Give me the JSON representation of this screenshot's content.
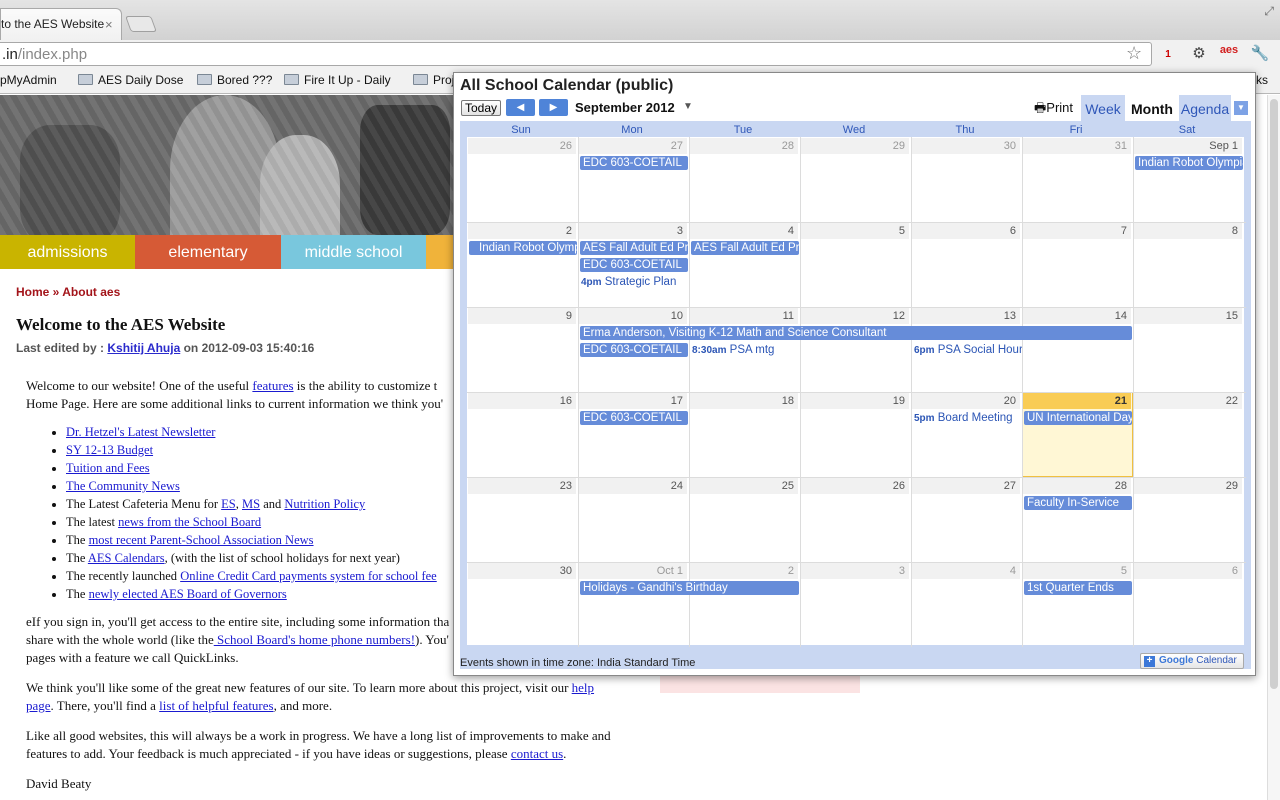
{
  "browser": {
    "tab_title": "to the AES Website",
    "tab_close": "×",
    "url_main": ".in",
    "url_path": "/index.php",
    "bookmarks": [
      "pMyAdmin",
      "AES Daily Dose",
      "Bored ???",
      "Fire It Up - Daily",
      "Proj"
    ],
    "bookmarks_right": "ks",
    "ext_badge": "1",
    "aes_icon_label": "aes"
  },
  "site": {
    "nav": [
      {
        "label": "admissions",
        "color": "#c9b400"
      },
      {
        "label": "elementary",
        "color": "#d65a36"
      },
      {
        "label": "middle school",
        "color": "#79c7dd"
      },
      {
        "label": "",
        "color": "#f0b33a"
      }
    ],
    "breadcrumb_home": "Home",
    "breadcrumb_sep": " » ",
    "breadcrumb_current": "About aes",
    "title": "Welcome to the AES Website",
    "edited_prefix": "Last edited by : ",
    "edited_user": "Kshitij Ahuja",
    "edited_on": "  on  2012-09-03 15:40:16",
    "intro_1": "Welcome to our  website! One of the useful ",
    "intro_link": "features",
    "intro_2": "  is the ability to customize t",
    "intro_3": "Home Page. Here are some additional links to current information we think you'",
    "links": [
      {
        "pre": "",
        "link": "Dr. Hetzel's Latest Newsletter",
        "post": ""
      },
      {
        "pre": "",
        "link": "SY 12-13 Budget",
        "post": ""
      },
      {
        "pre": "",
        "link": "Tuition and Fees",
        "post": ""
      },
      {
        "pre": "",
        "link": "The Community News",
        "post": ""
      },
      {
        "pre": "The Latest Cafeteria Menu for ",
        "link": "ES",
        "post": ", ",
        "link2": "MS",
        "post2": " and ",
        "link3": "Nutrition Policy"
      },
      {
        "pre": "The latest ",
        "link": "news from the School Board",
        "post": ""
      },
      {
        "pre": "The ",
        "link": "most recent Parent-School Association News",
        "post": ""
      },
      {
        "pre": "The ",
        "link": "AES Calendars",
        "post": ", (with the list of school holidays for next year)"
      },
      {
        "pre": "The recently launched ",
        "link": "Online Credit Card payments system for school fee",
        "post": ""
      },
      {
        "pre": "The ",
        "link": "newly elected AES Board of Governors",
        "post": ""
      }
    ],
    "para2_1": "eIf you sign in, you'll get access to the entire site, including some information tha",
    "para2_2": "share with the whole world (like the",
    "para2_link": " School Board's home phone numbers!",
    "para2_3": "). You'",
    "para2_4": "pages with a feature we call QuickLinks.",
    "para3_1": "We think you'll like some of the great new features of our site. To learn more about this project, visit our ",
    "para3_link1": "help",
    "para3_link1b": "page",
    "para3_2": ". There, you'll find a ",
    "para3_link2": "list of helpful  features",
    "para3_3": ", and more.",
    "para4_1": "Like all good websites, this will always be a work in progress. We have a long list of improvements to make and",
    "para4_2": "features to add. Your feedback is much appreciated - if you have ideas or suggestions, please ",
    "para4_link": "contact us",
    "para4_3": ".",
    "signature": "David Beaty"
  },
  "calendar": {
    "title": "All School Calendar (public)",
    "today_label": "Today",
    "prev_icon": "◀",
    "next_icon": "▶",
    "month_label": "September 2012",
    "print_label": "Print",
    "views": [
      "Week",
      "Month",
      "Agenda"
    ],
    "active_view": "Month",
    "days_of_week": [
      "Sun",
      "Mon",
      "Tue",
      "Wed",
      "Thu",
      "Fri",
      "Sat"
    ],
    "weeks": [
      [
        "26",
        "27",
        "28",
        "29",
        "30",
        "31",
        "Sep 1"
      ],
      [
        "2",
        "3",
        "4",
        "5",
        "6",
        "7",
        "8"
      ],
      [
        "9",
        "10",
        "11",
        "12",
        "13",
        "14",
        "15"
      ],
      [
        "16",
        "17",
        "18",
        "19",
        "20",
        "21",
        "22"
      ],
      [
        "23",
        "24",
        "25",
        "26",
        "27",
        "28",
        "29"
      ],
      [
        "30",
        "Oct 1",
        "2",
        "3",
        "4",
        "5",
        "6"
      ]
    ],
    "today": "21",
    "events": {
      "w0_mon": "EDC 603-COETAIL",
      "w0_sat": "Indian Robot Olympiad",
      "w1_sun": "Indian Robot Olympiad",
      "w1_mon_a": "AES Fall Adult Ed Program",
      "w1_tue_a": "AES Fall Adult Ed Program",
      "w1_mon_b": "EDC 603-COETAIL",
      "w1_mon_c_time": "4pm",
      "w1_mon_c": " Strategic Plan",
      "w2_span": "Erma Anderson, Visiting K-12 Math and Science Consultant",
      "w2_mon": "EDC 603-COETAIL",
      "w2_tue_time": "8:30am",
      "w2_tue": " PSA mtg",
      "w2_thu_time": "6pm",
      "w2_thu": " PSA Social Hour",
      "w3_mon": "EDC 603-COETAIL",
      "w3_thu_time": "5pm",
      "w3_thu": " Board Meeting",
      "w3_fri": "UN International Day of Peace",
      "w4_fri": "Faculty In-Service",
      "w5_span": "Holidays - Gandhi's Birthday",
      "w5_fri": "1st Quarter Ends"
    },
    "timezone": "Events shown in time zone: India Standard Time",
    "google_label": "Google",
    "gcal_label": " Calendar"
  }
}
